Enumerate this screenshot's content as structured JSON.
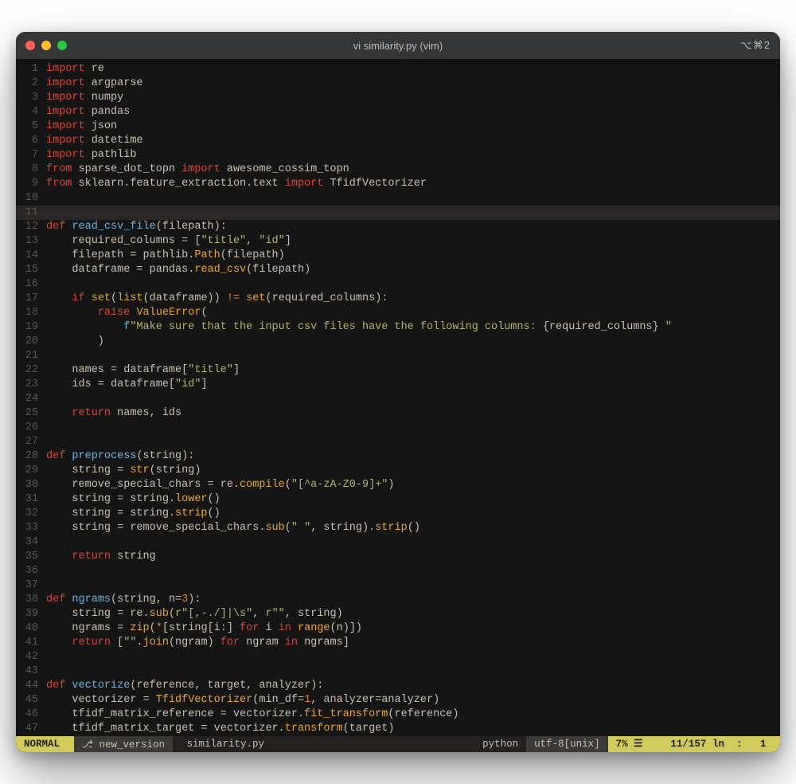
{
  "window": {
    "title": "vi similarity.py (vim)",
    "right_indicator": "⌥⌘2"
  },
  "status": {
    "mode": "NORMAL",
    "branch_icon": "⎇",
    "branch": "new_version",
    "filename": "similarity.py",
    "filetype": "python",
    "encoding": "utf-8[unix]",
    "percent": "7%",
    "percent_glyph": "☰",
    "position_line": "11/157",
    "position_col_label": "ln",
    "position_col": "1"
  },
  "editor": {
    "current_line": 11,
    "lines": [
      {
        "n": 1,
        "t": [
          [
            "kw",
            "import"
          ],
          [
            "id",
            " re"
          ]
        ]
      },
      {
        "n": 2,
        "t": [
          [
            "kw",
            "import"
          ],
          [
            "id",
            " argparse"
          ]
        ]
      },
      {
        "n": 3,
        "t": [
          [
            "kw",
            "import"
          ],
          [
            "id",
            " numpy"
          ]
        ]
      },
      {
        "n": 4,
        "t": [
          [
            "kw",
            "import"
          ],
          [
            "id",
            " pandas"
          ]
        ]
      },
      {
        "n": 5,
        "t": [
          [
            "kw",
            "import"
          ],
          [
            "id",
            " json"
          ]
        ]
      },
      {
        "n": 6,
        "t": [
          [
            "kw",
            "import"
          ],
          [
            "id",
            " datetime"
          ]
        ]
      },
      {
        "n": 7,
        "t": [
          [
            "kw",
            "import"
          ],
          [
            "id",
            " pathlib"
          ]
        ]
      },
      {
        "n": 8,
        "t": [
          [
            "kw",
            "from"
          ],
          [
            "id",
            " sparse_dot_topn "
          ],
          [
            "kw",
            "import"
          ],
          [
            "id",
            " awesome_cossim_topn"
          ]
        ]
      },
      {
        "n": 9,
        "t": [
          [
            "kw",
            "from"
          ],
          [
            "id",
            " sklearn.feature_extraction.text "
          ],
          [
            "kw",
            "import"
          ],
          [
            "id",
            " TfidfVectorizer"
          ]
        ]
      },
      {
        "n": 10,
        "t": [
          [
            "id",
            ""
          ]
        ]
      },
      {
        "n": 11,
        "t": [
          [
            "id",
            ""
          ]
        ]
      },
      {
        "n": 12,
        "t": [
          [
            "kw",
            "def"
          ],
          [
            "id",
            " "
          ],
          [
            "fn",
            "read_csv_file"
          ],
          [
            "id",
            "(filepath):"
          ]
        ]
      },
      {
        "n": 13,
        "t": [
          [
            "id",
            "    required_columns = ["
          ],
          [
            "str",
            "\"title\""
          ],
          [
            "id",
            ", "
          ],
          [
            "str",
            "\"id\""
          ],
          [
            "id",
            "]"
          ]
        ]
      },
      {
        "n": 14,
        "t": [
          [
            "id",
            "    filepath = pathlib."
          ],
          [
            "call",
            "Path"
          ],
          [
            "id",
            "(filepath)"
          ]
        ]
      },
      {
        "n": 15,
        "t": [
          [
            "id",
            "    dataframe = pandas."
          ],
          [
            "call",
            "read_csv"
          ],
          [
            "id",
            "(filepath)"
          ]
        ]
      },
      {
        "n": 16,
        "t": [
          [
            "id",
            ""
          ]
        ]
      },
      {
        "n": 17,
        "t": [
          [
            "id",
            "    "
          ],
          [
            "kw",
            "if"
          ],
          [
            "id",
            " "
          ],
          [
            "call",
            "set"
          ],
          [
            "id",
            "("
          ],
          [
            "call",
            "list"
          ],
          [
            "id",
            "(dataframe)) "
          ],
          [
            "cmp",
            "!="
          ],
          [
            "id",
            " "
          ],
          [
            "call",
            "set"
          ],
          [
            "id",
            "(required_columns):"
          ]
        ]
      },
      {
        "n": 18,
        "t": [
          [
            "id",
            "        "
          ],
          [
            "kw",
            "raise"
          ],
          [
            "id",
            " "
          ],
          [
            "call",
            "ValueError"
          ],
          [
            "id",
            "("
          ]
        ]
      },
      {
        "n": 19,
        "t": [
          [
            "id",
            "            "
          ],
          [
            "fn",
            "f"
          ],
          [
            "str",
            "\"Make sure that the input csv files have the following columns: "
          ],
          [
            "id",
            "{required_columns}"
          ],
          [
            "str",
            " \""
          ]
        ]
      },
      {
        "n": 20,
        "t": [
          [
            "id",
            "        )"
          ]
        ]
      },
      {
        "n": 21,
        "t": [
          [
            "id",
            ""
          ]
        ]
      },
      {
        "n": 22,
        "t": [
          [
            "id",
            "    names = dataframe["
          ],
          [
            "str",
            "\"title\""
          ],
          [
            "id",
            "]"
          ]
        ]
      },
      {
        "n": 23,
        "t": [
          [
            "id",
            "    ids = dataframe["
          ],
          [
            "str",
            "\"id\""
          ],
          [
            "id",
            "]"
          ]
        ]
      },
      {
        "n": 24,
        "t": [
          [
            "id",
            ""
          ]
        ]
      },
      {
        "n": 25,
        "t": [
          [
            "id",
            "    "
          ],
          [
            "kw",
            "return"
          ],
          [
            "id",
            " names, ids"
          ]
        ]
      },
      {
        "n": 26,
        "t": [
          [
            "id",
            ""
          ]
        ]
      },
      {
        "n": 27,
        "t": [
          [
            "id",
            ""
          ]
        ]
      },
      {
        "n": 28,
        "t": [
          [
            "kw",
            "def"
          ],
          [
            "id",
            " "
          ],
          [
            "fn",
            "preprocess"
          ],
          [
            "id",
            "(string):"
          ]
        ]
      },
      {
        "n": 29,
        "t": [
          [
            "id",
            "    string = "
          ],
          [
            "call",
            "str"
          ],
          [
            "id",
            "(string)"
          ]
        ]
      },
      {
        "n": 30,
        "t": [
          [
            "id",
            "    remove_special_chars = re."
          ],
          [
            "call",
            "compile"
          ],
          [
            "id",
            "("
          ],
          [
            "str",
            "\"[^a-zA-Z0-9]+\""
          ],
          [
            "id",
            ")"
          ]
        ]
      },
      {
        "n": 31,
        "t": [
          [
            "id",
            "    string = string."
          ],
          [
            "call",
            "lower"
          ],
          [
            "id",
            "()"
          ]
        ]
      },
      {
        "n": 32,
        "t": [
          [
            "id",
            "    string = string."
          ],
          [
            "call",
            "strip"
          ],
          [
            "id",
            "()"
          ]
        ]
      },
      {
        "n": 33,
        "t": [
          [
            "id",
            "    string = remove_special_chars."
          ],
          [
            "call",
            "sub"
          ],
          [
            "id",
            "("
          ],
          [
            "str",
            "\" \""
          ],
          [
            "id",
            ", string)."
          ],
          [
            "call",
            "strip"
          ],
          [
            "id",
            "()"
          ]
        ]
      },
      {
        "n": 34,
        "t": [
          [
            "id",
            ""
          ]
        ]
      },
      {
        "n": 35,
        "t": [
          [
            "id",
            "    "
          ],
          [
            "kw",
            "return"
          ],
          [
            "id",
            " string"
          ]
        ]
      },
      {
        "n": 36,
        "t": [
          [
            "id",
            ""
          ]
        ]
      },
      {
        "n": 37,
        "t": [
          [
            "id",
            ""
          ]
        ]
      },
      {
        "n": 38,
        "t": [
          [
            "kw",
            "def"
          ],
          [
            "id",
            " "
          ],
          [
            "fn",
            "ngrams"
          ],
          [
            "id",
            "(string, n="
          ],
          [
            "num",
            "3"
          ],
          [
            "id",
            "):"
          ]
        ]
      },
      {
        "n": 39,
        "t": [
          [
            "id",
            "    string = re."
          ],
          [
            "call",
            "sub"
          ],
          [
            "id",
            "("
          ],
          [
            "str",
            "r\"[,-./]|\\s\""
          ],
          [
            "id",
            ", "
          ],
          [
            "str",
            "r\"\""
          ],
          [
            "id",
            ", string)"
          ]
        ]
      },
      {
        "n": 40,
        "t": [
          [
            "id",
            "    ngrams = "
          ],
          [
            "call",
            "zip"
          ],
          [
            "id",
            "("
          ],
          [
            "star",
            "*"
          ],
          [
            "id",
            "[string[i:] "
          ],
          [
            "kw",
            "for"
          ],
          [
            "id",
            " i "
          ],
          [
            "kw",
            "in"
          ],
          [
            "id",
            " "
          ],
          [
            "call",
            "range"
          ],
          [
            "id",
            "(n)])"
          ]
        ]
      },
      {
        "n": 41,
        "t": [
          [
            "id",
            "    "
          ],
          [
            "kw",
            "return"
          ],
          [
            "id",
            " ["
          ],
          [
            "str",
            "\"\""
          ],
          [
            "id",
            "."
          ],
          [
            "call",
            "join"
          ],
          [
            "id",
            "(ngram) "
          ],
          [
            "kw",
            "for"
          ],
          [
            "id",
            " ngram "
          ],
          [
            "kw",
            "in"
          ],
          [
            "id",
            " ngrams]"
          ]
        ]
      },
      {
        "n": 42,
        "t": [
          [
            "id",
            ""
          ]
        ]
      },
      {
        "n": 43,
        "t": [
          [
            "id",
            ""
          ]
        ]
      },
      {
        "n": 44,
        "t": [
          [
            "kw",
            "def"
          ],
          [
            "id",
            " "
          ],
          [
            "fn",
            "vectorize"
          ],
          [
            "id",
            "(reference, target, analyzer):"
          ]
        ]
      },
      {
        "n": 45,
        "t": [
          [
            "id",
            "    vectorizer = "
          ],
          [
            "call",
            "TfidfVectorizer"
          ],
          [
            "id",
            "(min_df="
          ],
          [
            "num",
            "1"
          ],
          [
            "id",
            ", analyzer=analyzer)"
          ]
        ]
      },
      {
        "n": 46,
        "t": [
          [
            "id",
            "    tfidf_matrix_reference = vectorizer."
          ],
          [
            "call",
            "fit_transform"
          ],
          [
            "id",
            "(reference)"
          ]
        ]
      },
      {
        "n": 47,
        "t": [
          [
            "id",
            "    tfidf_matrix_target = vectorizer."
          ],
          [
            "call",
            "transform"
          ],
          [
            "id",
            "(target)"
          ]
        ]
      }
    ]
  }
}
